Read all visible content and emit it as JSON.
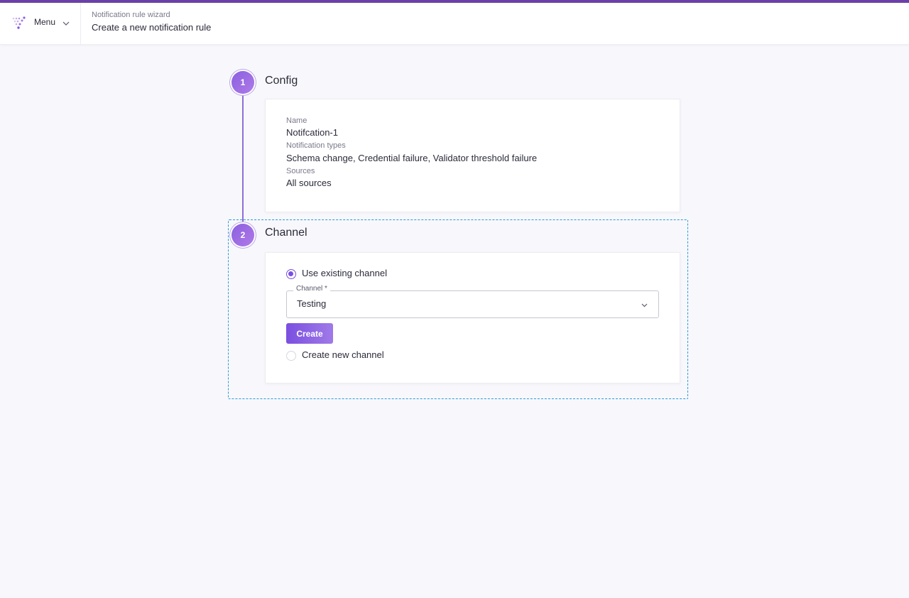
{
  "header": {
    "menu_label": "Menu",
    "breadcrumb_small": "Notification rule wizard",
    "breadcrumb_title": "Create a new notification rule"
  },
  "steps": [
    {
      "number": "1",
      "title": "Config"
    },
    {
      "number": "2",
      "title": "Channel"
    }
  ],
  "config": {
    "name_label": "Name",
    "name_value": "Notifcation-1",
    "types_label": "Notification types",
    "types_value": "Schema change, Credential failure, Validator threshold failure",
    "sources_label": "Sources",
    "sources_value": "All sources"
  },
  "channel": {
    "option_existing": "Use existing channel",
    "option_new": "Create new channel",
    "selected_option": "existing",
    "select_label": "Channel *",
    "select_value": "Testing",
    "create_button": "Create"
  },
  "colors": {
    "accent": "#7a4fe0",
    "top_bar": "#6b3fa8",
    "focus_outline": "#2a9ad6"
  },
  "icons": {
    "logo": "brand-logo-icon",
    "menu_chevron": "chevron-down-icon",
    "select_chevron": "chevron-down-icon"
  }
}
